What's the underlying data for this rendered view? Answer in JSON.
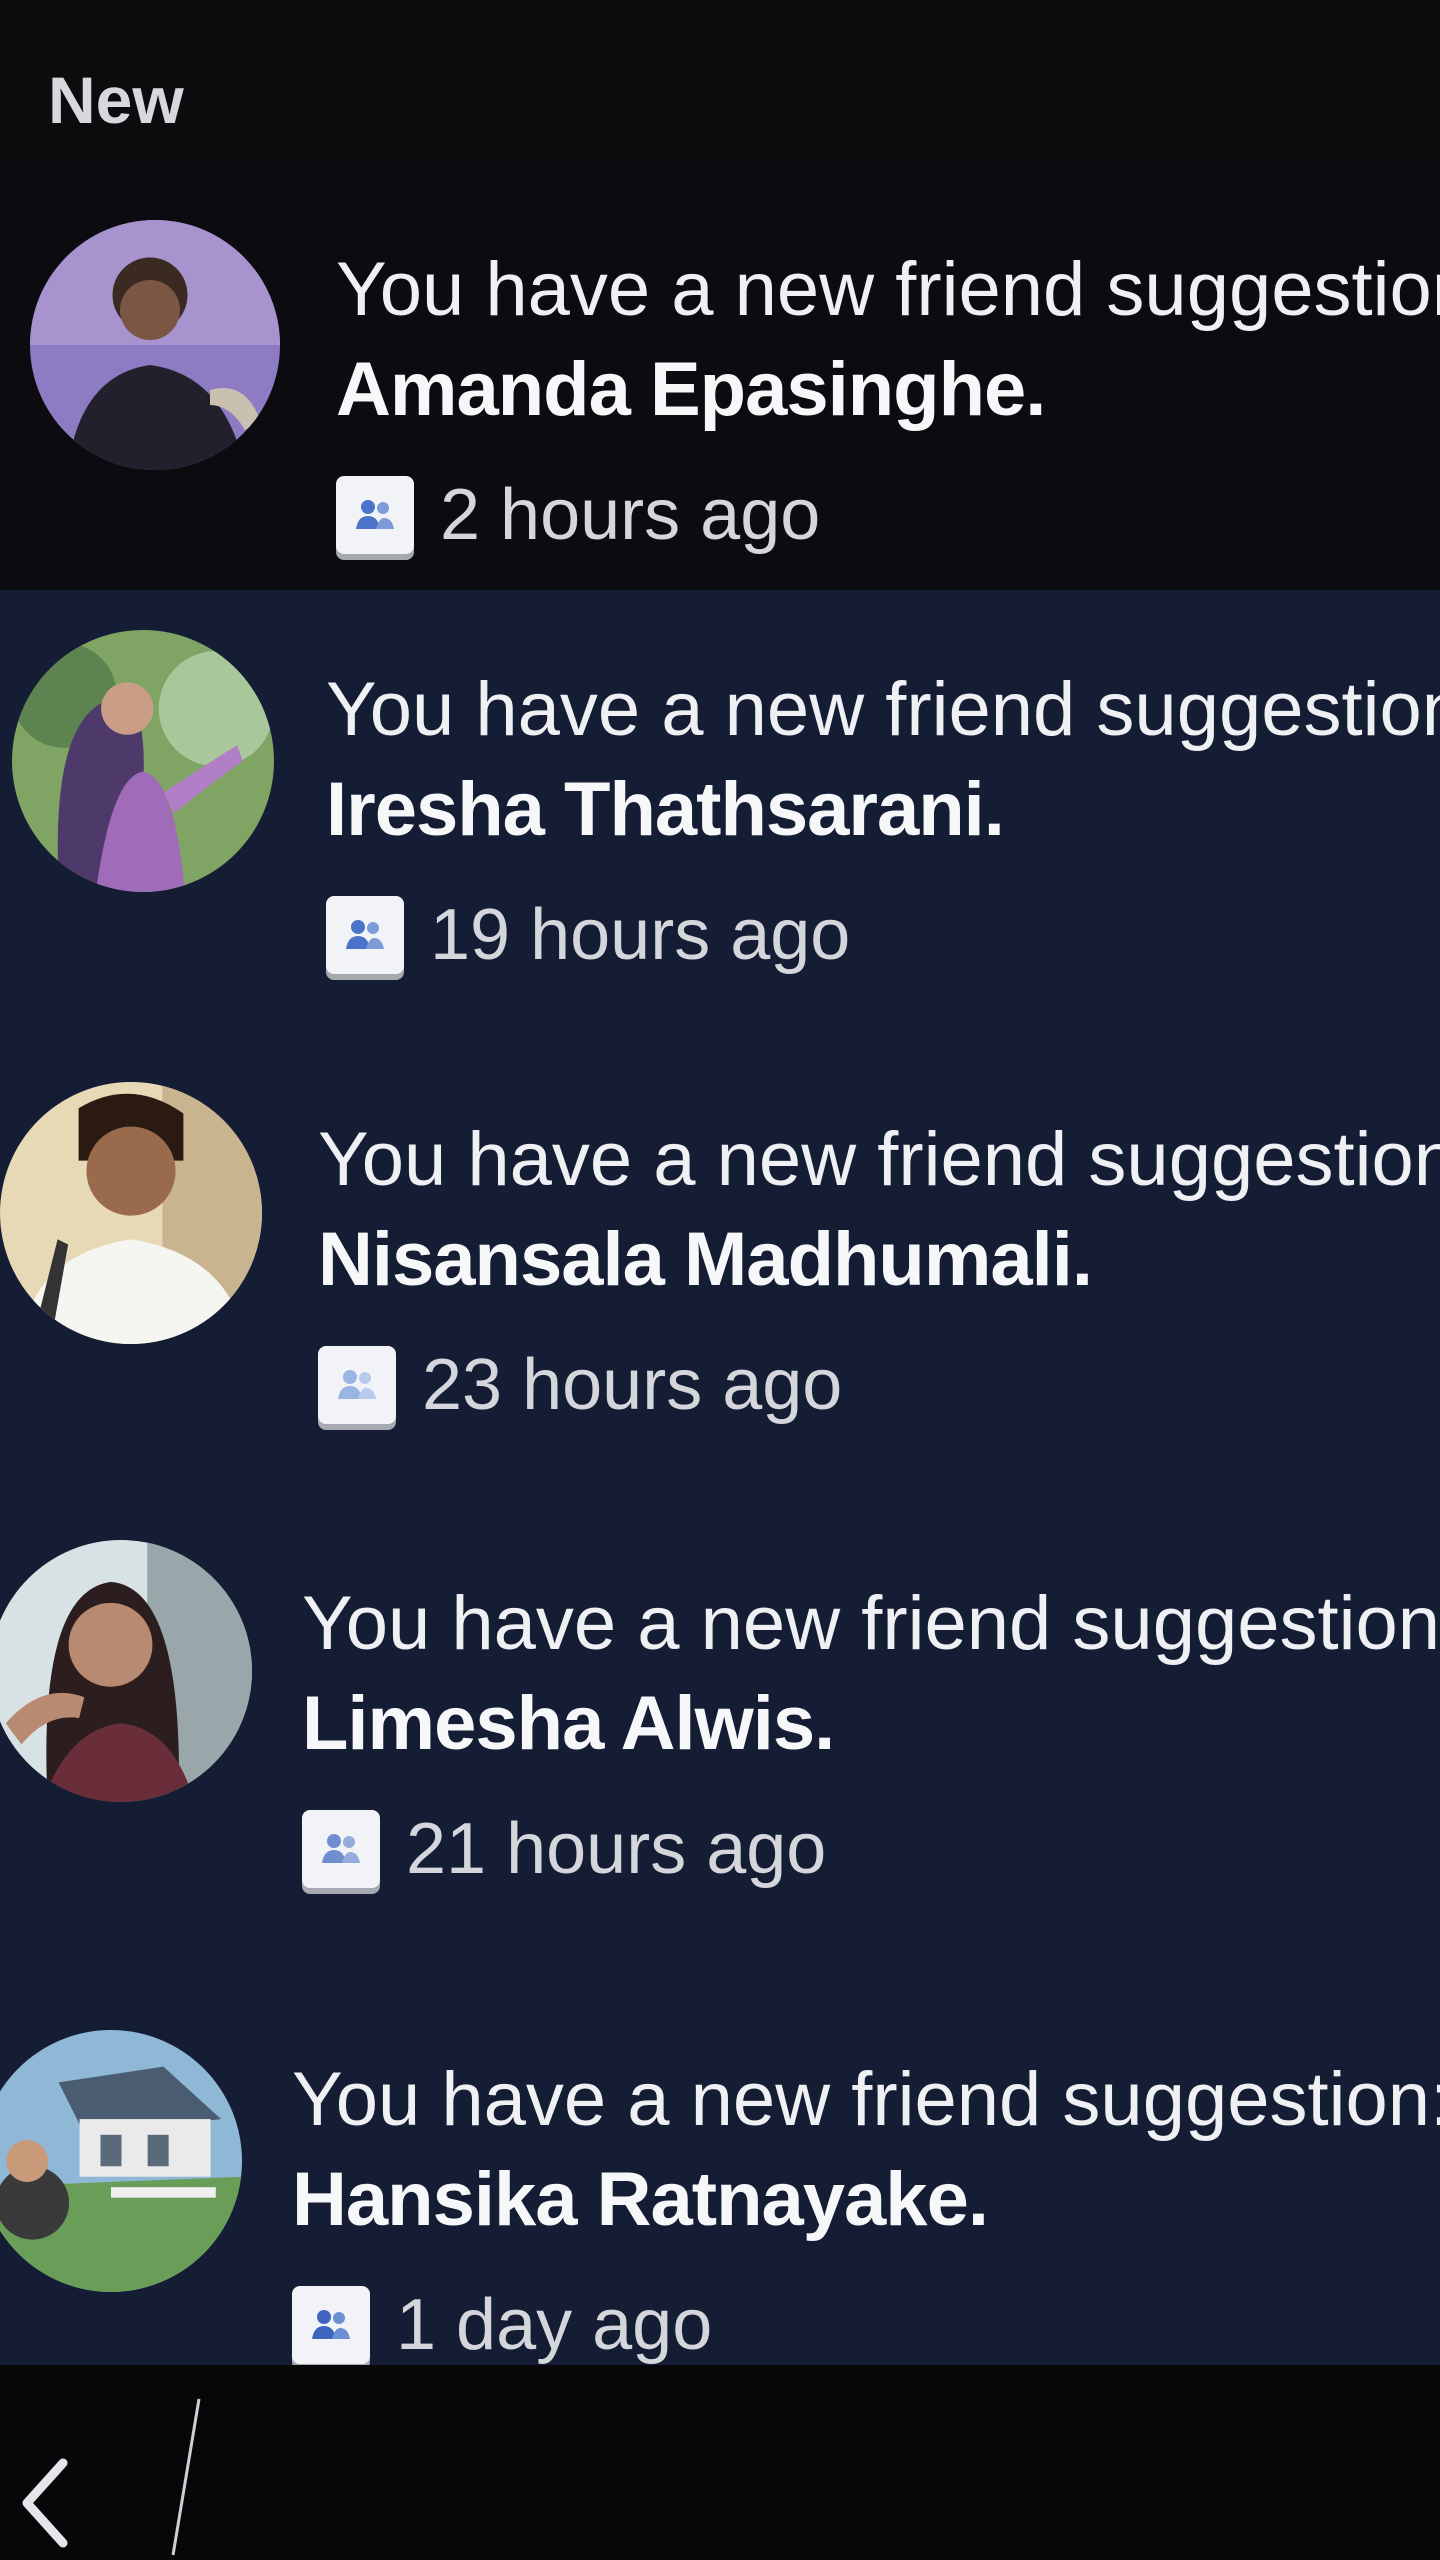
{
  "section": {
    "title": "New"
  },
  "notifications": [
    {
      "message": "You have a new friend suggestion:",
      "name": "Amanda Epasinghe.",
      "time": "2 hours ago",
      "state": "read",
      "avatar_colors": [
        "#8d7cc4",
        "#23202e"
      ]
    },
    {
      "message": "You have a new friend suggestion:",
      "name": "Iresha Thathsarani.",
      "time": "19 hours ago",
      "state": "unread",
      "avatar_colors": [
        "#7fa464",
        "#a06bb8"
      ]
    },
    {
      "message": "You have a new friend suggestion:",
      "name": "Nisansala Madhumali.",
      "time": "23 hours ago",
      "state": "unread",
      "avatar_colors": [
        "#e8d9b6",
        "#f5f5f2"
      ]
    },
    {
      "message": "You have a new friend suggestion:",
      "name": "Limesha Alwis.",
      "time": "21 hours ago",
      "state": "unread",
      "avatar_colors": [
        "#d8e2e4",
        "#2c1e1e"
      ]
    },
    {
      "message": "You have a new friend suggestion:",
      "name": "Hansika Ratnayake.",
      "time": "1 day ago",
      "state": "unread",
      "avatar_colors": [
        "#6a9e58",
        "#8fb8d6"
      ]
    }
  ],
  "icons": {
    "friend_badge": "people-icon",
    "back": "chevron-left-icon"
  },
  "colors": {
    "unread_bg": "#141d33",
    "read_bg": "#0c0c10",
    "badge_accent": "#4a73c9"
  }
}
